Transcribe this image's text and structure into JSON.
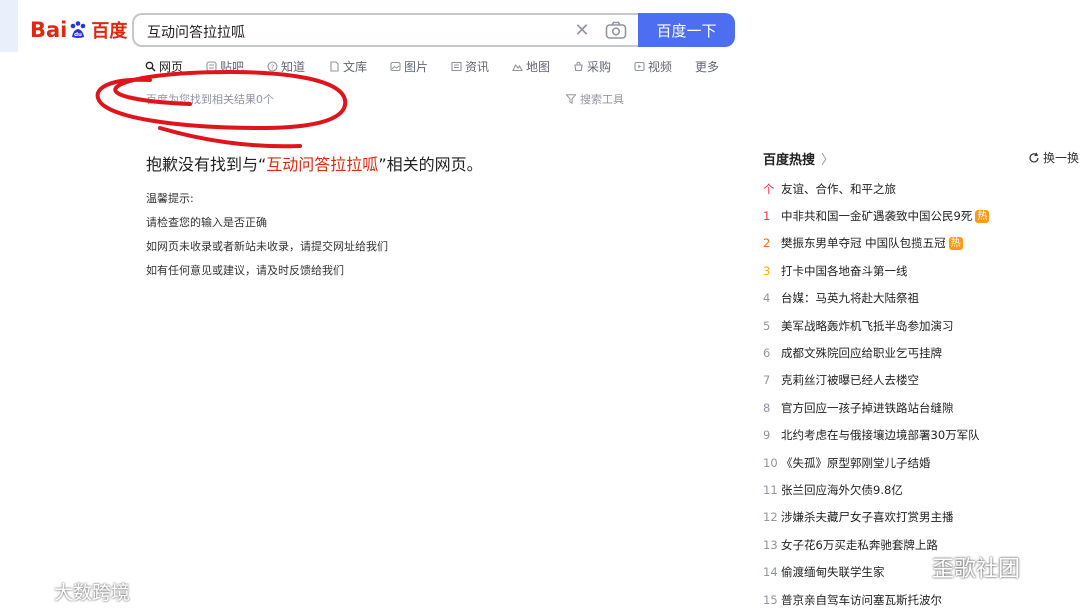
{
  "logo": {
    "bai": "Bai",
    "du": "du",
    "cn": "百度"
  },
  "search": {
    "query": "互动问答拉拉呱",
    "button": "百度一下"
  },
  "tabs": [
    {
      "label": "网页",
      "icon": "search-icon",
      "active": true
    },
    {
      "label": "贴吧",
      "icon": "tieba-icon"
    },
    {
      "label": "知道",
      "icon": "question-icon"
    },
    {
      "label": "文库",
      "icon": "document-icon"
    },
    {
      "label": "图片",
      "icon": "image-icon"
    },
    {
      "label": "资讯",
      "icon": "news-icon"
    },
    {
      "label": "地图",
      "icon": "map-icon"
    },
    {
      "label": "采购",
      "icon": "purchase-icon"
    },
    {
      "label": "视频",
      "icon": "video-icon"
    },
    {
      "label": "更多",
      "icon": ""
    }
  ],
  "result_count": "百度为您找到相关结果0个",
  "tools_label": "搜索工具",
  "noresult": {
    "prefix": "抱歉没有找到与“",
    "keyword": "互动问答拉拉呱",
    "suffix": "”相关的网页。"
  },
  "tips": {
    "title": "温馨提示:",
    "lines": [
      "请检查您的输入是否正确",
      "如网页未收录或者新站未收录，请提交网址给我们",
      "如有任何意见或建议，请及时反馈给我们"
    ]
  },
  "hot": {
    "title": "百度热搜",
    "refresh": "换一换",
    "items": [
      {
        "rank": "个",
        "text": "友谊、合作、和平之旅",
        "badge": ""
      },
      {
        "rank": "1",
        "text": "中非共和国一金矿遇袭致中国公民9死",
        "badge": "热"
      },
      {
        "rank": "2",
        "text": "樊振东男单夺冠 中国队包揽五冠",
        "badge": "热"
      },
      {
        "rank": "3",
        "text": "打卡中国各地奋斗第一线",
        "badge": ""
      },
      {
        "rank": "4",
        "text": "台媒：马英九将赴大陆祭祖",
        "badge": ""
      },
      {
        "rank": "5",
        "text": "美军战略轰炸机飞抵半岛参加演习",
        "badge": ""
      },
      {
        "rank": "6",
        "text": "成都文殊院回应给职业乞丐挂牌",
        "badge": ""
      },
      {
        "rank": "7",
        "text": "克莉丝汀被曝已经人去楼空",
        "badge": ""
      },
      {
        "rank": "8",
        "text": "官方回应一孩子掉进铁路站台缝隙",
        "badge": ""
      },
      {
        "rank": "9",
        "text": "北约考虑在与俄接壤边境部署30万军队",
        "badge": ""
      },
      {
        "rank": "10",
        "text": "《失孤》原型郭刚堂儿子结婚",
        "badge": ""
      },
      {
        "rank": "11",
        "text": "张兰回应海外欠债9.8亿",
        "badge": ""
      },
      {
        "rank": "12",
        "text": "涉嫌杀夫藏尸女子喜欢打赏男主播",
        "badge": ""
      },
      {
        "rank": "13",
        "text": "女子花6万买走私奔驰套牌上路",
        "badge": ""
      },
      {
        "rank": "14",
        "text": "偷渡缅甸失联学生家",
        "badge": ""
      },
      {
        "rank": "15",
        "text": "普京亲自驾车访问塞瓦斯托波尔",
        "badge": ""
      }
    ]
  },
  "watermarks": {
    "left": "大数跨境",
    "right": "歪歌社团"
  },
  "colors": {
    "accent": "#4e6ef2",
    "brand_red": "#de2910",
    "annotation_red": "#e0151b"
  }
}
